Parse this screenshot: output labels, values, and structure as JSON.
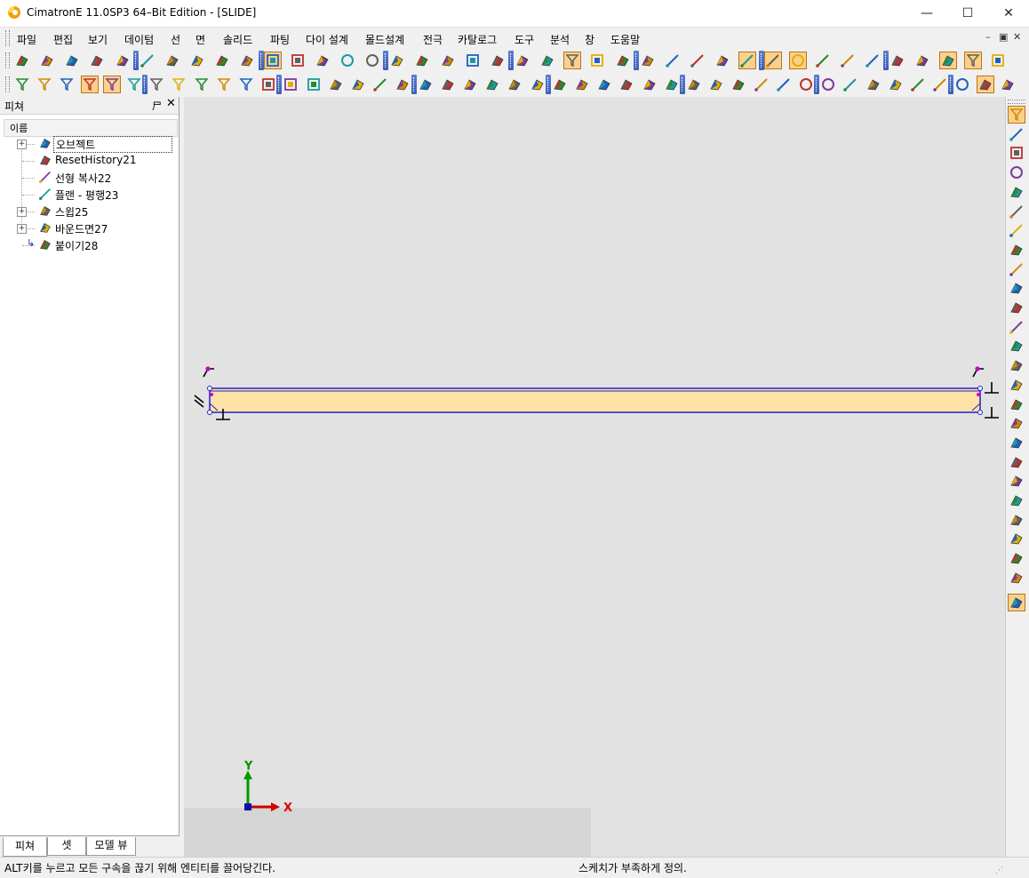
{
  "window": {
    "title": "CimatronE 11.0SP3 64–Bit Edition - [SLIDE]",
    "controls": {
      "minimize": "—",
      "maximize": "☐",
      "close": "✕"
    }
  },
  "menubar": {
    "items": [
      "파일",
      "편집",
      "보기",
      "데이텀",
      "선",
      "면",
      "솔리드",
      "파팅",
      "다이 설계",
      "몰드설계",
      "전극",
      "카탈로그",
      "도구",
      "분석",
      "창",
      "도움말"
    ],
    "mdi_controls": [
      "–",
      "▣",
      "✕"
    ]
  },
  "toolbars": {
    "row1_icons": [
      "new-file-icon",
      "open-folder-icon",
      "undo-icon",
      "redo-icon",
      "glasses-icon",
      "hierarchy-icon",
      "zoom-all-icon",
      "zoom-window-icon",
      "pan-zoom-icon",
      "rotate-icon",
      "shaded-box-icon",
      "wire-box-icon",
      "hide-icon",
      "light-bulb-icon",
      "light-bulb-yellow-icon",
      "light-off-icon",
      "previous-view-icon",
      "next-view-icon",
      "layers-icon",
      "measure-icon",
      "edit-icon",
      "paste-icon",
      "select-filter-icon",
      "color-grid-icon",
      "fill-color-icon",
      "pen-icon",
      "line-style-icon",
      "line-width-icon",
      "brush-icon",
      "line-green-icon",
      "line-red-icon",
      "circle-target-icon",
      "trim-icon",
      "parallel-icon",
      "cut-icon",
      "cross-icon",
      "plane-icon",
      "axis-active-icon",
      "cursor-active-icon",
      "frame-icon"
    ],
    "row2_icons": [
      "select-icon",
      "filter-icon",
      "curve-select-icon",
      "surface-select-icon",
      "face-select-icon",
      "highlight-filter-icon",
      "filter-down-icon",
      "face-filter-icon",
      "edge-filter-icon",
      "loop-filter-icon",
      "feature-filter-icon",
      "list-icon",
      "box-green-icon",
      "box-yellow-icon",
      "pocket-green-icon",
      "pocket-blue-icon",
      "pocket-outline-icon",
      "shell-icon",
      "round-icon",
      "chamfer-icon",
      "draft-icon",
      "hole-icon",
      "rib-icon",
      "split-icon",
      "sweep-icon",
      "loft-icon",
      "boundary-icon",
      "blend-icon",
      "extrude-icon",
      "offset-icon",
      "combine-icon",
      "mirror-book-icon",
      "mirror-page-icon",
      "cut-scissors-icon",
      "trim-arrow-icon",
      "grid-target-icon",
      "gear-target-icon",
      "wave-icon",
      "point-icon",
      "dot-icon",
      "line-icon",
      "spline-icon",
      "circle-icon",
      "sketch-active-icon",
      "exit-sketch-icon"
    ]
  },
  "feature_panel": {
    "title": "피쳐",
    "pin": "⼫",
    "close": "✕",
    "column_header": "이름",
    "tree": [
      {
        "label": "오브젝트",
        "icon": "object-icon",
        "expandable": true,
        "selected": true
      },
      {
        "label": "ResetHistory21",
        "icon": "reset-history-icon",
        "expandable": false
      },
      {
        "label": "선형 복사22",
        "icon": "linear-copy-icon",
        "expandable": false
      },
      {
        "label": "플랜 - 평행23",
        "icon": "plane-parallel-icon",
        "expandable": false
      },
      {
        "label": "스윕25",
        "icon": "sweep-icon",
        "expandable": true
      },
      {
        "label": "바운드면27",
        "icon": "boundary-face-icon",
        "expandable": true
      },
      {
        "label": "붙이기28",
        "icon": "attach-icon",
        "expandable": false,
        "current": true
      }
    ],
    "tabs": [
      "피쳐",
      "셋",
      "모델 뷰"
    ]
  },
  "viewport": {
    "axis_x": "X",
    "axis_y": "Y",
    "sketch_fill": "#ffe2a6",
    "sketch_stroke": "#2020d0"
  },
  "right_toolbar_icons": [
    "pointer-icon",
    "line-tool-icon",
    "rectangle-icon",
    "circle-tool-icon",
    "ellipse-icon",
    "arc-icon",
    "spline-tool-icon",
    "point-tool-icon",
    "centerline-icon",
    "offset-tool-icon",
    "fillet-tool-icon",
    "trim-tool-icon",
    "extend-tool-icon",
    "copy-tool-icon",
    "mirror-tool-icon",
    "move-tool-icon",
    "dimension-icon",
    "ellipse-dash-icon",
    "constraint-icon",
    "constraint-add-icon",
    "pattern-icon",
    "pattern-delete-icon",
    "fix-icon",
    "delete-constraint-icon",
    "tools-icon",
    "exit-icon"
  ],
  "statusbar": {
    "left": "ALT키를 누르고 모든 구속을 끊기 위해 엔티티를 끌어당긴다.",
    "middle": "스케치가 부족하게 정의."
  },
  "colors": {
    "active_highlight": "#fbd08a",
    "toolbar_separator": "#3a5fb8",
    "viewport_bg": "#e2e2e2"
  }
}
